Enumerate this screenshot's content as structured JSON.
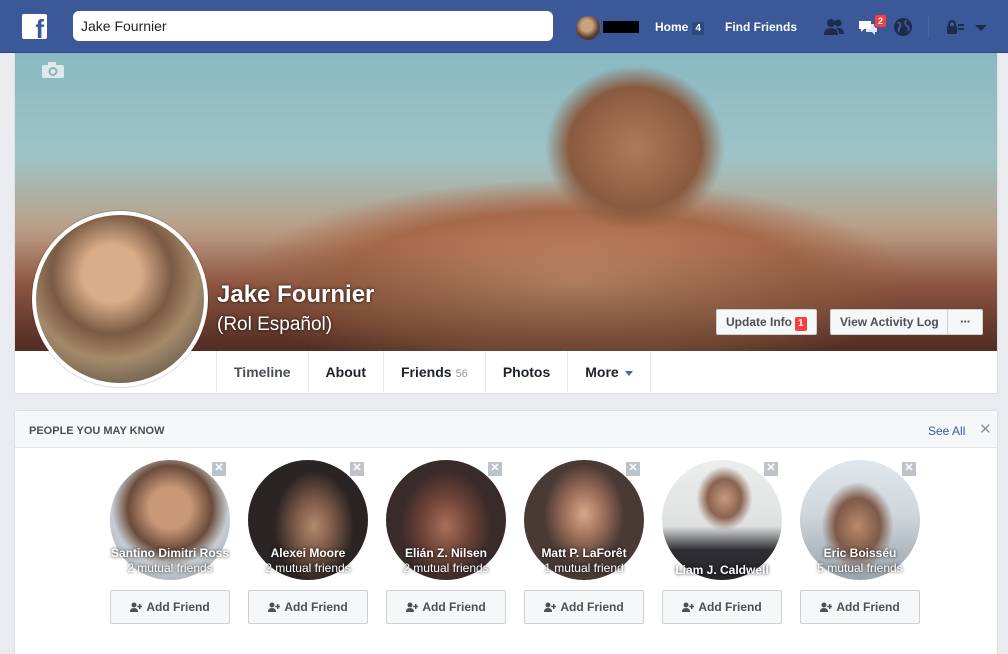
{
  "header": {
    "search_value": "Jake Fournier",
    "home_label": "Home",
    "home_count": "4",
    "find_friends_label": "Find Friends",
    "messages_badge": "2",
    "brand_color": "#3b5998"
  },
  "profile": {
    "name": "Jake Fournier",
    "alternate_name": "(Rol Español)",
    "update_info_label": "Update Info",
    "update_info_badge": "1",
    "view_activity_log_label": "View Activity Log",
    "more_options_label": "···"
  },
  "tabs": [
    {
      "label": "Timeline"
    },
    {
      "label": "About"
    },
    {
      "label": "Friends",
      "count": "56"
    },
    {
      "label": "Photos"
    },
    {
      "label": "More"
    }
  ],
  "pymk": {
    "title": "PEOPLE YOU MAY KNOW",
    "see_all_label": "See All",
    "add_friend_label": "Add Friend",
    "people": [
      {
        "name": "Santino Dimitri Ross",
        "mutual": "2 mutual friends"
      },
      {
        "name": "Alexei Moore",
        "mutual": "2 mutual friends"
      },
      {
        "name": "Elián Z. Nilsen",
        "mutual": "2 mutual friends"
      },
      {
        "name": "Matt P. LaForêt",
        "mutual": "1 mutual friend"
      },
      {
        "name": "Liam J. Caldwell",
        "mutual": ""
      },
      {
        "name": "Eric Boisséu",
        "mutual": "5 mutual friends"
      }
    ]
  }
}
